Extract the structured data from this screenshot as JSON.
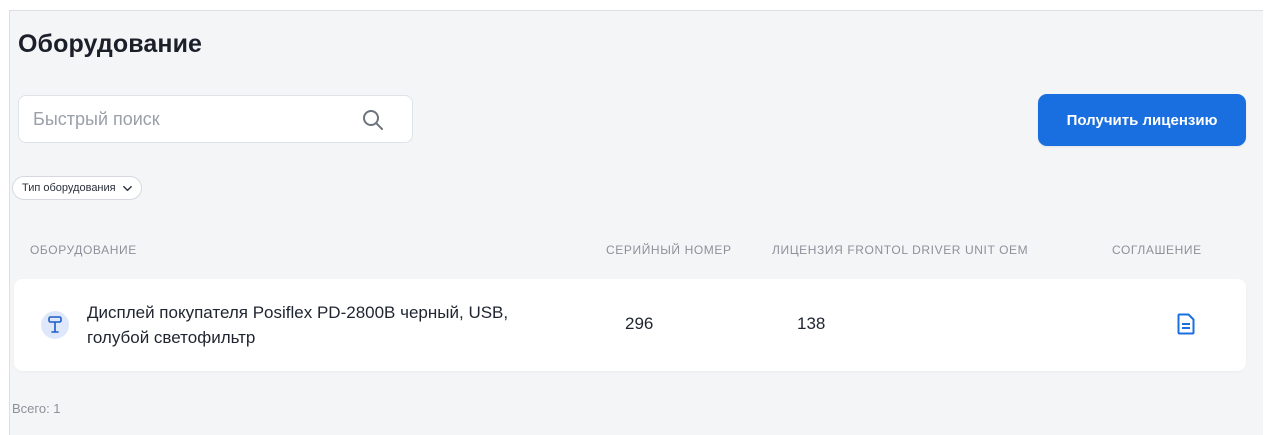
{
  "page": {
    "title": "Оборудование"
  },
  "search": {
    "placeholder": "Быстрый поиск",
    "value": "",
    "icon": "search-icon"
  },
  "actions": {
    "get_license_label": "Получить лицензию"
  },
  "filters": {
    "equipment_type_label": "Тип оборудования",
    "icon": "chevron-down-icon"
  },
  "table": {
    "headers": {
      "equipment": "ОБОРУДОВАНИЕ",
      "serial": "СЕРИЙНЫЙ НОМЕР",
      "license": "ЛИЦЕНЗИЯ FRONTOL DRIVER UNIT OEM",
      "agreement": "СОГЛАШЕНИЕ"
    },
    "rows": [
      {
        "name": "Дисплей покупателя Posiflex PD-2800B черный, USB, голубой светофильтр",
        "serial": "296",
        "license": "138",
        "type_icon": "customer-display-icon",
        "agreement_icon": "document-icon"
      }
    ],
    "total_label": "Всего: 1"
  },
  "colors": {
    "accent": "#1a6fe0",
    "background": "#f4f5f7",
    "icon_bg": "#dfe8fb"
  }
}
